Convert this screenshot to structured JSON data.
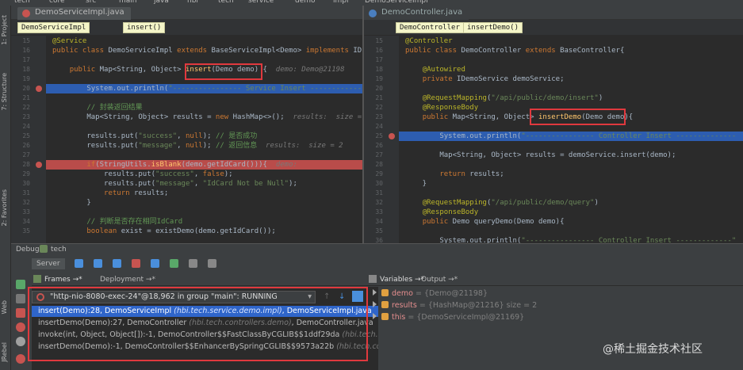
{
  "nav": {
    "items": [
      "tech",
      "core",
      "src",
      "main",
      "java",
      "hbi",
      "tech",
      "service",
      "demo",
      "impl",
      "DemoServiceImpl"
    ]
  },
  "tool_windows": {
    "project": "1: Project",
    "structure": "7: Structure",
    "favorites": "2: Favorites",
    "web": "Web",
    "jrebel": "JRebel"
  },
  "left_editor": {
    "tab": "DemoServiceImpl.java",
    "breadcrumb": [
      "DemoServiceImpl",
      "insert()"
    ],
    "lines": [
      {
        "n": "15",
        "html_parts": [
          [
            "an",
            "@Service"
          ]
        ]
      },
      {
        "n": "16",
        "html_parts": [
          [
            "kw",
            "public class "
          ],
          [
            "",
            "DemoServiceImpl "
          ],
          [
            "kw",
            "extends "
          ],
          [
            "",
            "BaseServiceImpl<Demo> "
          ],
          [
            "kw",
            "implements "
          ],
          [
            "",
            "ID"
          ]
        ]
      },
      {
        "n": "17",
        "html_parts": []
      },
      {
        "n": "18",
        "html_parts": [
          [
            "",
            "    "
          ],
          [
            "kw",
            "public "
          ],
          [
            "",
            "Map<String, Object> "
          ],
          [
            "fn",
            "insert"
          ],
          [
            "",
            "(Demo demo) {  "
          ],
          [
            "hint",
            "demo: Demo@21198"
          ]
        ]
      },
      {
        "n": "19",
        "html_parts": []
      },
      {
        "n": "20",
        "html_parts": [
          [
            "",
            "        System."
          ],
          [
            "",
            "out"
          ],
          [
            "",
            ".println("
          ],
          [
            "st",
            "\"---------------- Service Insert ------------"
          ]
        ],
        "hl": "blue"
      },
      {
        "n": "21",
        "html_parts": []
      },
      {
        "n": "22",
        "html_parts": [
          [
            "",
            "        "
          ],
          [
            "cmt",
            "// 封装返回结果"
          ]
        ]
      },
      {
        "n": "23",
        "html_parts": [
          [
            "",
            "        Map<String, Object> results = "
          ],
          [
            "kw",
            "new "
          ],
          [
            "",
            "HashMap<>();  "
          ],
          [
            "hint",
            "results:  size ="
          ]
        ]
      },
      {
        "n": "24",
        "html_parts": []
      },
      {
        "n": "25",
        "html_parts": [
          [
            "",
            "        results.put("
          ],
          [
            "st",
            "\"success\""
          ],
          [
            "",
            ", "
          ],
          [
            "kw",
            "null"
          ],
          [
            "",
            "); "
          ],
          [
            "cmt",
            "// 是否成功"
          ]
        ]
      },
      {
        "n": "26",
        "html_parts": [
          [
            "",
            "        results.put("
          ],
          [
            "st",
            "\"message\""
          ],
          [
            "",
            ", "
          ],
          [
            "kw",
            "null"
          ],
          [
            "",
            "); "
          ],
          [
            "cmt",
            "// 返回信息  "
          ],
          [
            "hint",
            "results:  size = 2"
          ]
        ]
      },
      {
        "n": "27",
        "html_parts": []
      },
      {
        "n": "28",
        "html_parts": [
          [
            "",
            "        "
          ],
          [
            "kw",
            "if"
          ],
          [
            "",
            "(StringUtils."
          ],
          [
            "fn",
            "isBlank"
          ],
          [
            "",
            "(demo.getIdCard())){  "
          ],
          [
            "hint",
            "demo:"
          ]
        ],
        "hl": "red"
      },
      {
        "n": "29",
        "html_parts": [
          [
            "",
            "            results.put("
          ],
          [
            "st",
            "\"success\""
          ],
          [
            "",
            ", "
          ],
          [
            "kw",
            "false"
          ],
          [
            "",
            ");"
          ]
        ]
      },
      {
        "n": "30",
        "html_parts": [
          [
            "",
            "            results.put("
          ],
          [
            "st",
            "\"message\""
          ],
          [
            "",
            ", "
          ],
          [
            "st",
            "\"IdCard Not be Null\""
          ],
          [
            "",
            ");"
          ]
        ]
      },
      {
        "n": "31",
        "html_parts": [
          [
            "",
            "            "
          ],
          [
            "kw",
            "return "
          ],
          [
            "",
            "results;"
          ]
        ]
      },
      {
        "n": "32",
        "html_parts": [
          [
            "",
            "        }"
          ]
        ]
      },
      {
        "n": "33",
        "html_parts": []
      },
      {
        "n": "34",
        "html_parts": [
          [
            "",
            "        "
          ],
          [
            "cmt",
            "// 判断是否存在相同IdCard"
          ]
        ]
      },
      {
        "n": "35",
        "html_parts": [
          [
            "",
            "        "
          ],
          [
            "kw",
            "boolean "
          ],
          [
            "",
            "exist = existDemo(demo.getIdCard());"
          ]
        ]
      }
    ]
  },
  "right_editor": {
    "tab": "DemoController.java",
    "breadcrumb": [
      "DemoController",
      "insertDemo()"
    ],
    "lines": [
      {
        "n": "15",
        "html_parts": [
          [
            "an",
            "@Controller"
          ]
        ]
      },
      {
        "n": "16",
        "html_parts": [
          [
            "kw",
            "public class "
          ],
          [
            "",
            "DemoController "
          ],
          [
            "kw",
            "extends "
          ],
          [
            "",
            "BaseController{"
          ]
        ]
      },
      {
        "n": "17",
        "html_parts": []
      },
      {
        "n": "18",
        "html_parts": [
          [
            "",
            "    "
          ],
          [
            "an",
            "@Autowired"
          ]
        ]
      },
      {
        "n": "19",
        "html_parts": [
          [
            "",
            "    "
          ],
          [
            "kw",
            "private "
          ],
          [
            "",
            "IDemoService demoService;"
          ]
        ]
      },
      {
        "n": "20",
        "html_parts": []
      },
      {
        "n": "21",
        "html_parts": [
          [
            "",
            "    "
          ],
          [
            "an",
            "@RequestMapping"
          ],
          [
            "",
            "("
          ],
          [
            "st",
            "\"/api/public/demo/insert\""
          ],
          [
            "",
            ")"
          ]
        ]
      },
      {
        "n": "22",
        "html_parts": [
          [
            "",
            "    "
          ],
          [
            "an",
            "@ResponseBody"
          ]
        ]
      },
      {
        "n": "23",
        "html_parts": [
          [
            "",
            "    "
          ],
          [
            "kw",
            "public "
          ],
          [
            "",
            "Map<String, Object> "
          ],
          [
            "fn",
            "insertDemo"
          ],
          [
            "",
            "(Demo demo){"
          ]
        ]
      },
      {
        "n": "24",
        "html_parts": []
      },
      {
        "n": "25",
        "html_parts": [
          [
            "",
            "        System."
          ],
          [
            "",
            "out"
          ],
          [
            "",
            ".println("
          ],
          [
            "st",
            "\"---------------- Controller Insert --------------"
          ]
        ],
        "hl": "blue"
      },
      {
        "n": "26",
        "html_parts": []
      },
      {
        "n": "27",
        "html_parts": [
          [
            "",
            "        Map<String, Object> results = demoService.insert(demo);"
          ]
        ]
      },
      {
        "n": "28",
        "html_parts": []
      },
      {
        "n": "29",
        "html_parts": [
          [
            "",
            "        "
          ],
          [
            "kw",
            "return "
          ],
          [
            "",
            "results;"
          ]
        ]
      },
      {
        "n": "30",
        "html_parts": [
          [
            "",
            "    }"
          ]
        ]
      },
      {
        "n": "31",
        "html_parts": []
      },
      {
        "n": "32",
        "html_parts": [
          [
            "",
            "    "
          ],
          [
            "an",
            "@RequestMapping"
          ],
          [
            "",
            "("
          ],
          [
            "st",
            "\"/api/public/demo/query\""
          ],
          [
            "",
            ")"
          ]
        ]
      },
      {
        "n": "33",
        "html_parts": [
          [
            "",
            "    "
          ],
          [
            "an",
            "@ResponseBody"
          ]
        ]
      },
      {
        "n": "34",
        "html_parts": [
          [
            "",
            "    "
          ],
          [
            "kw",
            "public "
          ],
          [
            "",
            "Demo queryDemo(Demo demo){"
          ]
        ]
      },
      {
        "n": "35",
        "html_parts": []
      },
      {
        "n": "36",
        "html_parts": [
          [
            "",
            "        System."
          ],
          [
            "",
            "out"
          ],
          [
            "",
            ".println("
          ],
          [
            "st",
            "\"---------------- Controller Insert -------------\""
          ]
        ]
      }
    ]
  },
  "debug": {
    "title": "Debug",
    "config": "tech",
    "server_tab": "Server",
    "frames_tab": "Frames",
    "deployment_tab": "Deployment",
    "variables_tab": "Variables",
    "output_tab": "Output",
    "thread": "\"http-nio-8080-exec-24\"@18,962 in group \"main\": RUNNING",
    "frames": [
      {
        "method": "insert(Demo):28, DemoServiceImpl",
        "pkg": "(hbi.tech.service.demo.impl)",
        "file": ", DemoServiceImpl.java"
      },
      {
        "method": "insertDemo(Demo):27, DemoController",
        "pkg": "(hbi.tech.controllers.demo)",
        "file": ", DemoController.java"
      },
      {
        "method": "invoke(int, Object, Object[]):-1, DemoController$$FastClassByCGLIB$$1ddf29da",
        "pkg": "(hbi.tech.con",
        "file": ""
      },
      {
        "method": "insertDemo(Demo):-1, DemoController$$EnhancerBySpringCGLIB$$9573a22b",
        "pkg": "(hbi.tech.cont",
        "file": ""
      }
    ],
    "variables": [
      {
        "name": "demo",
        "value": "= {Demo@21198}"
      },
      {
        "name": "results",
        "value": "= {HashMap@21216}  size = 2"
      },
      {
        "name": "this",
        "value": "= {DemoServiceImpl@21169}"
      }
    ]
  },
  "watermark": "@稀土掘金技术社区",
  "colors": {
    "accent_red": "#e0393e",
    "breakpoint_blue": "#2d5db0",
    "breakpoint_red": "#b94c4a"
  }
}
